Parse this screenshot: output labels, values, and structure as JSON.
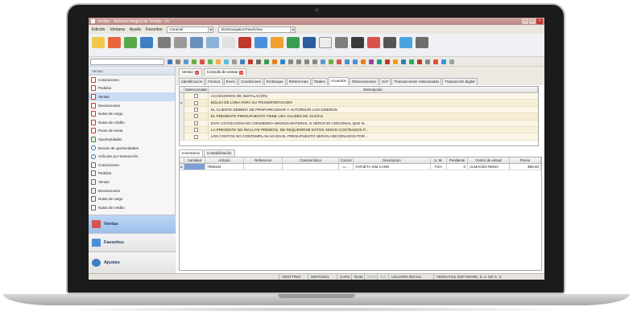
{
  "window": {
    "title": "Ventas - Sistema Integral de Ventas - vs",
    "buttons": [
      "–",
      "□",
      "×"
    ]
  },
  "menubar": {
    "items": [
      "Edición",
      "Ventana",
      "Ayuda",
      "Favoritos"
    ],
    "theme_combo": "Caramel",
    "skin_combo": "SkinNavigationPanelView"
  },
  "sidebar": {
    "header": "Ventas",
    "items": [
      {
        "label": "Cotizaciones",
        "icon": "red-doc-icon"
      },
      {
        "label": "Pedidos",
        "icon": "red-doc-icon"
      },
      {
        "label": "Ventas",
        "icon": "red-doc-icon",
        "selected": true
      },
      {
        "label": "Devoluciones",
        "icon": "red-doc-icon"
      },
      {
        "label": "Notas de cargo",
        "icon": "red-doc-icon"
      },
      {
        "label": "Notas de crédito",
        "icon": "red-doc-icon"
      },
      {
        "label": "Punto de venta",
        "icon": "red-doc-icon"
      },
      {
        "label": "Oportunidades",
        "icon": "green-icon"
      },
      {
        "label": "Buscar de oportunidades",
        "icon": "search-icon"
      },
      {
        "label": "Artículos por transacción",
        "icon": "search-icon"
      },
      {
        "label": "Cotizaciones",
        "icon": "doc-icon"
      },
      {
        "label": "Pedidos",
        "icon": "doc-icon"
      },
      {
        "label": "Ventas",
        "icon": "doc-icon"
      },
      {
        "label": "Devoluciones",
        "icon": "doc-icon"
      },
      {
        "label": "Notas de cargo",
        "icon": "doc-icon"
      },
      {
        "label": "Notas de crédito",
        "icon": "doc-icon"
      }
    ],
    "nav": [
      {
        "label": "Ventas",
        "active": true
      },
      {
        "label": "Favoritos",
        "active": false
      },
      {
        "label": "Ajustes",
        "active": false
      }
    ]
  },
  "doc_tabs": [
    "Ventas",
    "Consulta de ventas"
  ],
  "sub_tabs": [
    "Identificación",
    "Factura",
    "Envío",
    "Condiciones",
    "Embarque",
    "Referencias",
    "Totales",
    "Acuerdos",
    "Observaciones",
    "SAT",
    "Transacciones relacionadas",
    "Transacción digital"
  ],
  "active_sub_tab": "Acuerdos",
  "agreements_grid": {
    "headers": [
      "Seleccionado",
      "Descripción"
    ],
    "rows": [
      "ACCESORIOS DE INSTALACIÓN",
      "BOLSA DE LONA PARA SU TRANSPORTACIÓN",
      "EL CLIENTE DEBERÁ DE PROPORCIONAR Y AUTORIZAR LOS DISEÑOS",
      "EL PRESENTE PRESUPUESTO TIENE UNA VALIDEZ DE 15 DÍAS",
      "ESTA COTIZACIÓN NO CONSIDERA NINGÚN MATERIAL O SERVICIO ADICIONAL QUE N...",
      "LA PRESENTE NO INCLUYE PREMIOS. DE REQUERIRSE ESTOS SERÁN COSTEADOS P...",
      "LOS COSTOS NO CONTEMPLAN IVA EN EL PRESUPUESTO SERÁN ADICIONADOS POR..."
    ]
  },
  "bottom_tabs": [
    "Inventarios",
    "Contabilización"
  ],
  "items_grid": {
    "headers": [
      "Cantidad",
      "Artículo",
      "Referencia",
      "Característica",
      "Control",
      "Descripción",
      "U. M.",
      "Pendiente",
      "Centro de entrad",
      "Precio"
    ],
    "rows": [
      {
        "cantidad": "",
        "articulo": "7905334",
        "referencia": "",
        "caracteristica": "",
        "control": "",
        "descripcion": "TARJETA SIM CARD",
        "um": "PZA",
        "pendiente": "0",
        "centro": "ALMACÉN REMA",
        "precio": "$58.00"
      }
    ]
  },
  "statusbar": {
    "cells": [
      "VENTTR03",
      "06/07/2021",
      "CAPS",
      "NUM",
      "SCRL",
      "INS",
      "USUARIO INICIAL",
      "VERSATILE SOFTWARE, S. A. DE C. V."
    ]
  },
  "colors": {
    "titlebar": "#b98783",
    "selection": "#c9dcf3",
    "grid_row": "#fbf6e6",
    "qty_cell": "#7e9fd8"
  }
}
